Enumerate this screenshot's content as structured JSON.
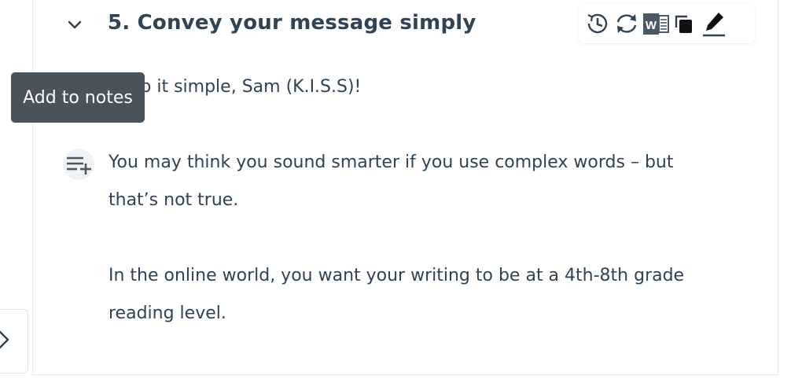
{
  "section": {
    "title": "5. Convey your message simply"
  },
  "toolbar": {
    "icons": [
      "history-icon",
      "refresh-icon",
      "word-export-icon",
      "copy-icon",
      "edit-icon"
    ]
  },
  "content": {
    "paragraph1": "Keep it simple, Sam (K.I.S.S)!",
    "paragraph2_line1": "You may think you sound smarter if you use complex words – but",
    "paragraph2_line2": "that’s not true.",
    "paragraph3_line1": "In the online world, you want your writing to be at a 4th-8th grade",
    "paragraph3_line2": "reading level."
  },
  "tooltip": {
    "text": "Add to notes"
  },
  "colors": {
    "text": "#2f4356",
    "tooltip_bg": "#4a525c",
    "border": "#e8ebee"
  }
}
